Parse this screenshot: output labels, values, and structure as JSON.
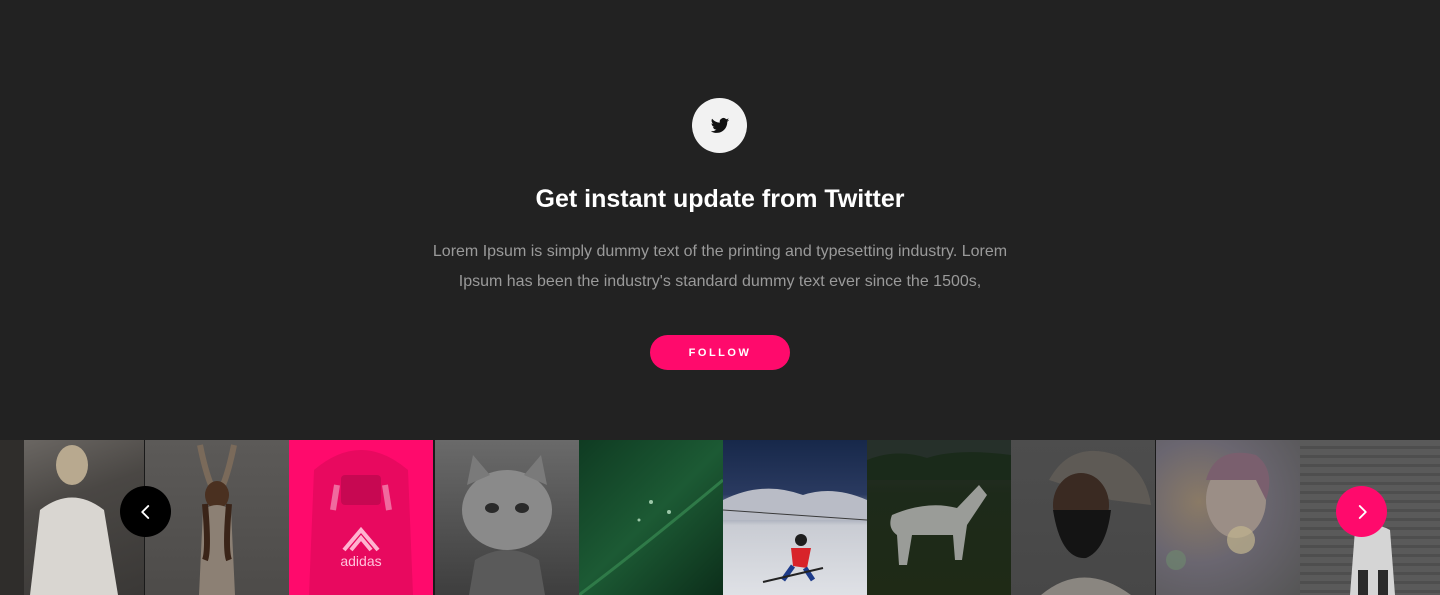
{
  "hero": {
    "icon": "twitter-icon",
    "title": "Get instant update from Twitter",
    "description": "Lorem Ipsum is simply dummy text of the printing and typesetting industry. Lorem Ipsum has been the industry's standard dummy text ever since the 1500s,",
    "follow_label": "FOLLOW"
  },
  "gallery": {
    "prev_icon": "chevron-left-icon",
    "next_icon": "chevron-right-icon",
    "items": [
      {
        "subject": "woman-in-white-shirt"
      },
      {
        "subject": "woman-stretching"
      },
      {
        "subject": "person-in-pink-hoodie",
        "caption": "adidas"
      },
      {
        "subject": "cat"
      },
      {
        "subject": "green-leaf"
      },
      {
        "subject": "skier"
      },
      {
        "subject": "white-horse"
      },
      {
        "subject": "bearded-man"
      },
      {
        "subject": "woman-with-bokeh"
      },
      {
        "subject": "person-by-wall"
      }
    ]
  },
  "colors": {
    "background": "#222222",
    "accent": "#ff0a6c",
    "text_muted": "#9a9a9a"
  }
}
